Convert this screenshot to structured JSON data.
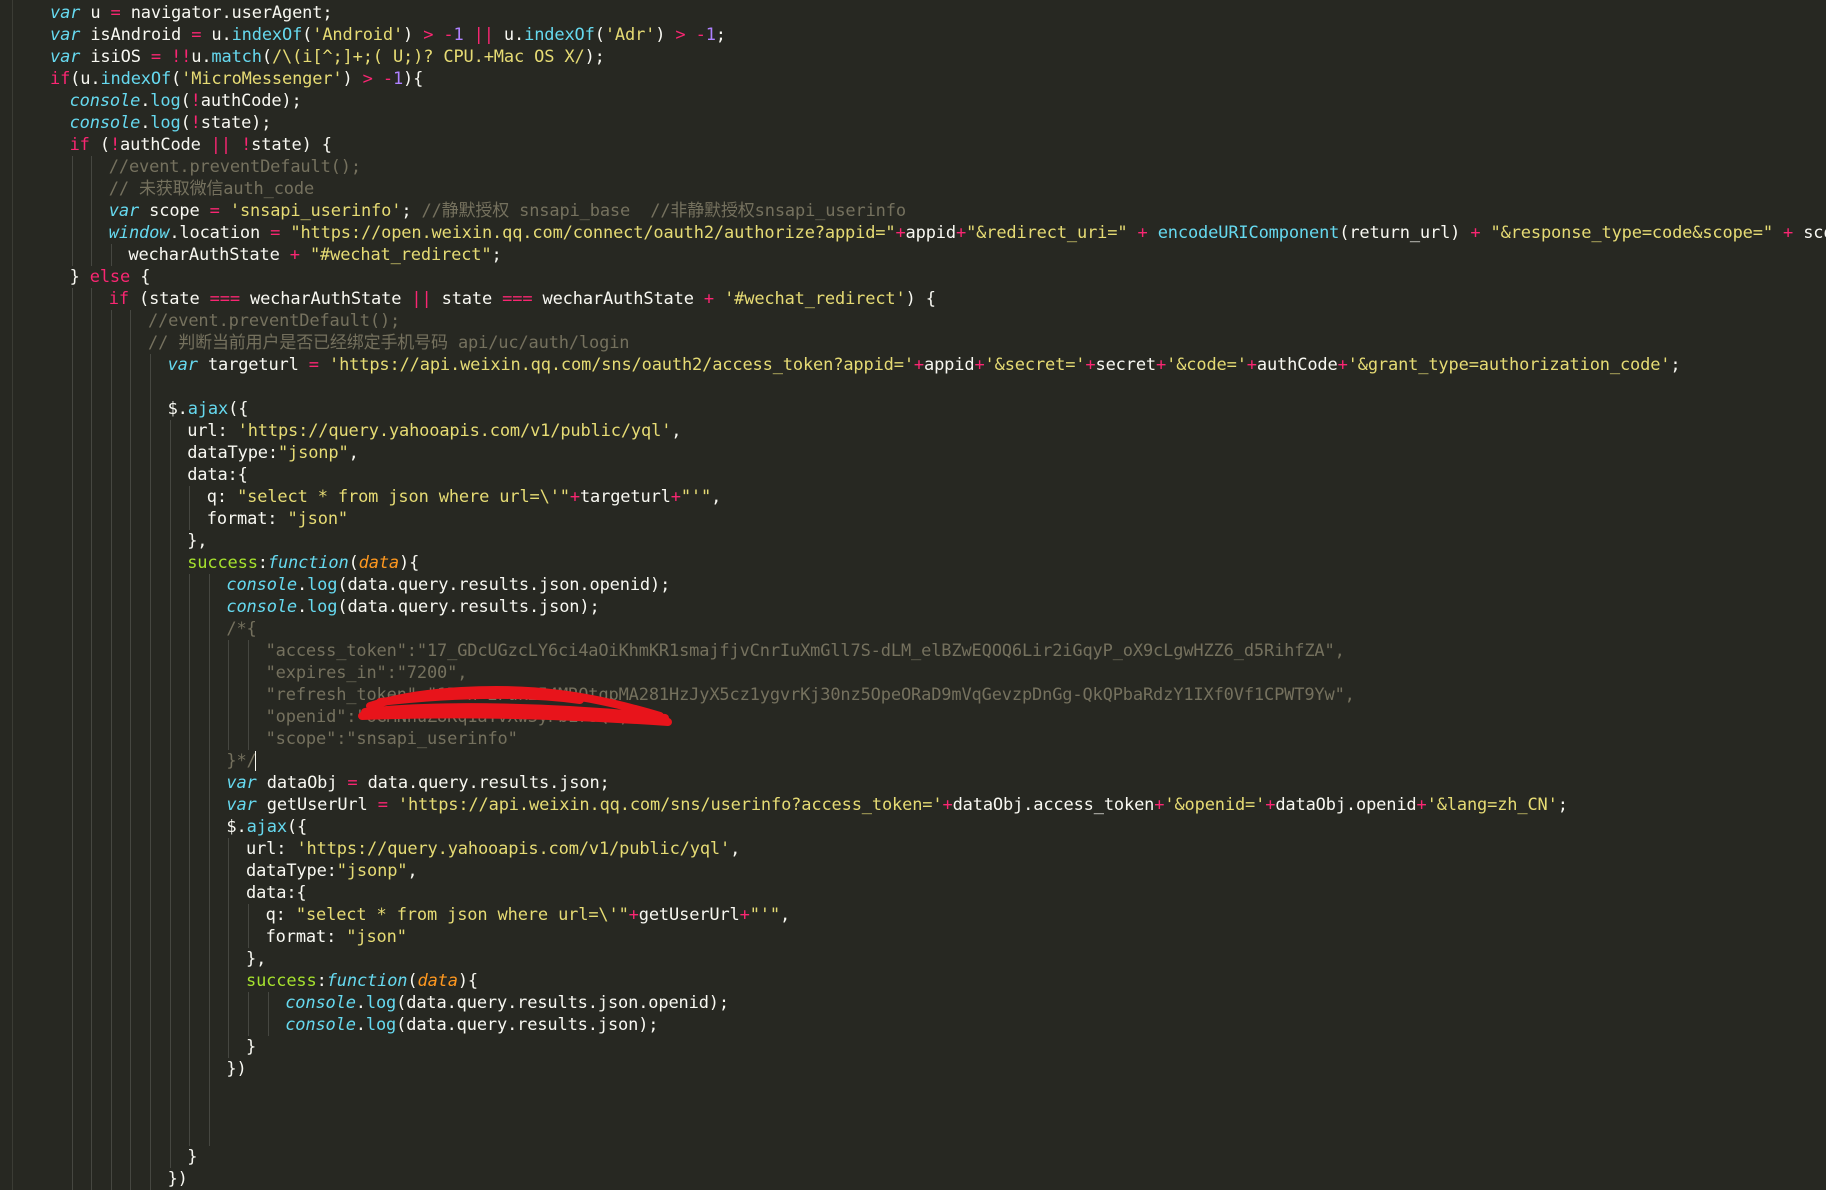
{
  "editor": {
    "colors": {
      "background": "#272822",
      "text": "#f8f8f2",
      "keyword": "#66d9ef",
      "operator": "#f92672",
      "string": "#e6db74",
      "number": "#ae81ff",
      "param": "#fd971f",
      "property": "#a6e22e",
      "comment": "#75715e",
      "redaction": "#e8141b"
    },
    "lines": [
      {
        "indent": 0,
        "tokens": [
          [
            "kw",
            "var"
          ],
          [
            "tx",
            " u "
          ],
          [
            "op",
            "="
          ],
          [
            "tx",
            " navigator.userAgent;"
          ]
        ]
      },
      {
        "indent": 0,
        "tokens": [
          [
            "kw",
            "var"
          ],
          [
            "tx",
            " isAndroid "
          ],
          [
            "op",
            "="
          ],
          [
            "tx",
            " u."
          ],
          [
            "fn",
            "indexOf"
          ],
          [
            "tx",
            "("
          ],
          [
            "st",
            "'Android'"
          ],
          [
            "tx",
            ") "
          ],
          [
            "op",
            ">"
          ],
          [
            "tx",
            " "
          ],
          [
            "op",
            "-"
          ],
          [
            "nu",
            "1"
          ],
          [
            "tx",
            " "
          ],
          [
            "op",
            "||"
          ],
          [
            "tx",
            " u."
          ],
          [
            "fn",
            "indexOf"
          ],
          [
            "tx",
            "("
          ],
          [
            "st",
            "'Adr'"
          ],
          [
            "tx",
            ") "
          ],
          [
            "op",
            ">"
          ],
          [
            "tx",
            " "
          ],
          [
            "op",
            "-"
          ],
          [
            "nu",
            "1"
          ],
          [
            "tx",
            ";"
          ]
        ]
      },
      {
        "indent": 0,
        "tokens": [
          [
            "kw",
            "var"
          ],
          [
            "tx",
            " isiOS "
          ],
          [
            "op",
            "="
          ],
          [
            "tx",
            " "
          ],
          [
            "op",
            "!!"
          ],
          [
            "tx",
            "u."
          ],
          [
            "fn",
            "match"
          ],
          [
            "tx",
            "("
          ],
          [
            "st",
            "/\\(i[^;]+;( U;)? CPU.+Mac OS X/"
          ],
          [
            "tx",
            ");"
          ]
        ]
      },
      {
        "indent": 0,
        "tokens": [
          [
            "kr",
            "if"
          ],
          [
            "tx",
            "(u."
          ],
          [
            "fn",
            "indexOf"
          ],
          [
            "tx",
            "("
          ],
          [
            "st",
            "'MicroMessenger'"
          ],
          [
            "tx",
            ") "
          ],
          [
            "op",
            ">"
          ],
          [
            "tx",
            " "
          ],
          [
            "op",
            "-"
          ],
          [
            "nu",
            "1"
          ],
          [
            "tx",
            "){"
          ]
        ]
      },
      {
        "indent": 1,
        "tokens": [
          [
            "kw",
            "console"
          ],
          [
            "tx",
            "."
          ],
          [
            "fn",
            "log"
          ],
          [
            "tx",
            "("
          ],
          [
            "op",
            "!"
          ],
          [
            "tx",
            "authCode);"
          ]
        ]
      },
      {
        "indent": 1,
        "tokens": [
          [
            "kw",
            "console"
          ],
          [
            "tx",
            "."
          ],
          [
            "fn",
            "log"
          ],
          [
            "tx",
            "("
          ],
          [
            "op",
            "!"
          ],
          [
            "tx",
            "state);"
          ]
        ]
      },
      {
        "indent": 1,
        "tokens": [
          [
            "kr",
            "if"
          ],
          [
            "tx",
            " ("
          ],
          [
            "op",
            "!"
          ],
          [
            "tx",
            "authCode "
          ],
          [
            "op",
            "||"
          ],
          [
            "tx",
            " "
          ],
          [
            "op",
            "!"
          ],
          [
            "tx",
            "state) {"
          ]
        ]
      },
      {
        "indent": 3,
        "tokens": [
          [
            "cm",
            "//event.preventDefault();"
          ]
        ]
      },
      {
        "indent": 3,
        "tokens": [
          [
            "cm",
            "// 未获取微信auth_code"
          ]
        ]
      },
      {
        "indent": 3,
        "tokens": [
          [
            "kw",
            "var"
          ],
          [
            "tx",
            " scope "
          ],
          [
            "op",
            "="
          ],
          [
            "tx",
            " "
          ],
          [
            "st",
            "'snsapi_userinfo'"
          ],
          [
            "tx",
            "; "
          ],
          [
            "cm",
            "//静默授权 snsapi_base  //非静默授权snsapi_userinfo"
          ]
        ]
      },
      {
        "indent": 3,
        "tokens": [
          [
            "kw",
            "window"
          ],
          [
            "tx",
            ".location "
          ],
          [
            "op",
            "="
          ],
          [
            "tx",
            " "
          ],
          [
            "st",
            "\"https://open.weixin.qq.com/connect/oauth2/authorize?appid=\""
          ],
          [
            "op",
            "+"
          ],
          [
            "tx",
            "appid"
          ],
          [
            "op",
            "+"
          ],
          [
            "st",
            "\"&redirect_uri=\""
          ],
          [
            "tx",
            " "
          ],
          [
            "op",
            "+"
          ],
          [
            "tx",
            " "
          ],
          [
            "fn",
            "encodeURIComponent"
          ],
          [
            "tx",
            "(return_url) "
          ],
          [
            "op",
            "+"
          ],
          [
            "tx",
            " "
          ],
          [
            "st",
            "\"&response_type=code&scope=\""
          ],
          [
            "tx",
            " "
          ],
          [
            "op",
            "+"
          ],
          [
            "tx",
            " scop"
          ]
        ]
      },
      {
        "indent": 4,
        "tokens": [
          [
            "tx",
            "wecharAuthState "
          ],
          [
            "op",
            "+"
          ],
          [
            "tx",
            " "
          ],
          [
            "st",
            "\"#wechat_redirect\""
          ],
          [
            "tx",
            ";"
          ]
        ]
      },
      {
        "indent": 1,
        "tokens": [
          [
            "tx",
            "} "
          ],
          [
            "kr",
            "else"
          ],
          [
            "tx",
            " {"
          ]
        ]
      },
      {
        "indent": 3,
        "tokens": [
          [
            "kr",
            "if"
          ],
          [
            "tx",
            " (state "
          ],
          [
            "op",
            "==="
          ],
          [
            "tx",
            " wecharAuthState "
          ],
          [
            "op",
            "||"
          ],
          [
            "tx",
            " state "
          ],
          [
            "op",
            "==="
          ],
          [
            "tx",
            " wecharAuthState "
          ],
          [
            "op",
            "+"
          ],
          [
            "tx",
            " "
          ],
          [
            "st",
            "'#wechat_redirect'"
          ],
          [
            "tx",
            ") {"
          ]
        ]
      },
      {
        "indent": 5,
        "tokens": [
          [
            "cm",
            "//event.preventDefault();"
          ]
        ]
      },
      {
        "indent": 5,
        "tokens": [
          [
            "cm",
            "// 判断当前用户是否已经绑定手机号码 api/uc/auth/login"
          ]
        ]
      },
      {
        "indent": 6,
        "tokens": [
          [
            "kw",
            "var"
          ],
          [
            "tx",
            " targeturl "
          ],
          [
            "op",
            "="
          ],
          [
            "tx",
            " "
          ],
          [
            "st",
            "'https://api.weixin.qq.com/sns/oauth2/access_token?appid='"
          ],
          [
            "op",
            "+"
          ],
          [
            "tx",
            "appid"
          ],
          [
            "op",
            "+"
          ],
          [
            "st",
            "'&secret='"
          ],
          [
            "op",
            "+"
          ],
          [
            "tx",
            "secret"
          ],
          [
            "op",
            "+"
          ],
          [
            "st",
            "'&code='"
          ],
          [
            "op",
            "+"
          ],
          [
            "tx",
            "authCode"
          ],
          [
            "op",
            "+"
          ],
          [
            "st",
            "'&grant_type=authorization_code'"
          ],
          [
            "tx",
            ";"
          ]
        ]
      },
      {
        "indent": 0,
        "tokens": []
      },
      {
        "indent": 6,
        "tokens": [
          [
            "tx",
            "$."
          ],
          [
            "fn",
            "ajax"
          ],
          [
            "tx",
            "({"
          ]
        ]
      },
      {
        "indent": 7,
        "tokens": [
          [
            "tx",
            "url: "
          ],
          [
            "st",
            "'https://query.yahooapis.com/v1/public/yql'"
          ],
          [
            "tx",
            ","
          ]
        ]
      },
      {
        "indent": 7,
        "tokens": [
          [
            "tx",
            "dataType:"
          ],
          [
            "st",
            "\"jsonp\""
          ],
          [
            "tx",
            ","
          ]
        ]
      },
      {
        "indent": 7,
        "tokens": [
          [
            "tx",
            "data:{"
          ]
        ]
      },
      {
        "indent": 8,
        "tokens": [
          [
            "tx",
            "q: "
          ],
          [
            "st",
            "\"select * from json where url=\\'\""
          ],
          [
            "op",
            "+"
          ],
          [
            "tx",
            "targeturl"
          ],
          [
            "op",
            "+"
          ],
          [
            "st",
            "\"'\""
          ],
          [
            "tx",
            ","
          ]
        ]
      },
      {
        "indent": 8,
        "tokens": [
          [
            "tx",
            "format: "
          ],
          [
            "st",
            "\"json\""
          ]
        ]
      },
      {
        "indent": 7,
        "tokens": [
          [
            "tx",
            "},"
          ]
        ]
      },
      {
        "indent": 7,
        "tokens": [
          [
            "pr",
            "success"
          ],
          [
            "tx",
            ":"
          ],
          [
            "kw",
            "function"
          ],
          [
            "tx",
            "("
          ],
          [
            "pa",
            "data"
          ],
          [
            "tx",
            "){"
          ]
        ]
      },
      {
        "indent": 9,
        "tokens": [
          [
            "kw",
            "console"
          ],
          [
            "tx",
            "."
          ],
          [
            "fn",
            "log"
          ],
          [
            "tx",
            "(data.query.results.json.openid);"
          ]
        ]
      },
      {
        "indent": 9,
        "tokens": [
          [
            "kw",
            "console"
          ],
          [
            "tx",
            "."
          ],
          [
            "fn",
            "log"
          ],
          [
            "tx",
            "(data.query.results.json);"
          ]
        ]
      },
      {
        "indent": 9,
        "tokens": [
          [
            "cm",
            "/*{"
          ]
        ]
      },
      {
        "indent": 11,
        "tokens": [
          [
            "cm",
            "\"access_token\":\"17_GDcUGzcLY6ci4aOiKhmKR1smajfjvCnrIuXmGll7S-dLM_elBZwEQOQ6Lir2iGqyP_oX9cLgwHZZ6_d5RihfZA\","
          ]
        ]
      },
      {
        "indent": 11,
        "tokens": [
          [
            "cm",
            "\"expires_in\":\"7200\","
          ]
        ]
      },
      {
        "indent": 11,
        "tokens": [
          [
            "cm",
            "\"refresh_token\":\"17_n_2Fuk254MROtqpMA281HzJyX5cz1ygvrKj30nz5OpeORaD9mVqGevzpDnGg-QkQPbaRdzY1IXf0Vf1CPWT9Yw\","
          ]
        ]
      },
      {
        "indent": 11,
        "tokens": [
          [
            "cm",
            "\"openid\":\"oGMNhuZ8Kq1aTvXw3yPbE7sQ\","
          ]
        ]
      },
      {
        "indent": 11,
        "tokens": [
          [
            "cm",
            "\"scope\":\"snsapi_userinfo\""
          ]
        ]
      },
      {
        "indent": 9,
        "tokens": [
          [
            "cm",
            "}*/"
          ]
        ]
      },
      {
        "indent": 9,
        "tokens": [
          [
            "kw",
            "var"
          ],
          [
            "tx",
            " dataObj "
          ],
          [
            "op",
            "="
          ],
          [
            "tx",
            " data.query.results.json;"
          ]
        ]
      },
      {
        "indent": 9,
        "tokens": [
          [
            "kw",
            "var"
          ],
          [
            "tx",
            " getUserUrl "
          ],
          [
            "op",
            "="
          ],
          [
            "tx",
            " "
          ],
          [
            "st",
            "'https://api.weixin.qq.com/sns/userinfo?access_token='"
          ],
          [
            "op",
            "+"
          ],
          [
            "tx",
            "dataObj.access_token"
          ],
          [
            "op",
            "+"
          ],
          [
            "st",
            "'&openid='"
          ],
          [
            "op",
            "+"
          ],
          [
            "tx",
            "dataObj.openid"
          ],
          [
            "op",
            "+"
          ],
          [
            "st",
            "'&lang=zh_CN'"
          ],
          [
            "tx",
            ";"
          ]
        ]
      },
      {
        "indent": 9,
        "tokens": [
          [
            "tx",
            "$."
          ],
          [
            "fn",
            "ajax"
          ],
          [
            "tx",
            "({"
          ]
        ]
      },
      {
        "indent": 10,
        "tokens": [
          [
            "tx",
            "url: "
          ],
          [
            "st",
            "'https://query.yahooapis.com/v1/public/yql'"
          ],
          [
            "tx",
            ","
          ]
        ]
      },
      {
        "indent": 10,
        "tokens": [
          [
            "tx",
            "dataType:"
          ],
          [
            "st",
            "\"jsonp\""
          ],
          [
            "tx",
            ","
          ]
        ]
      },
      {
        "indent": 10,
        "tokens": [
          [
            "tx",
            "data:{"
          ]
        ]
      },
      {
        "indent": 11,
        "tokens": [
          [
            "tx",
            "q: "
          ],
          [
            "st",
            "\"select * from json where url=\\'\""
          ],
          [
            "op",
            "+"
          ],
          [
            "tx",
            "getUserUrl"
          ],
          [
            "op",
            "+"
          ],
          [
            "st",
            "\"'\""
          ],
          [
            "tx",
            ","
          ]
        ]
      },
      {
        "indent": 11,
        "tokens": [
          [
            "tx",
            "format: "
          ],
          [
            "st",
            "\"json\""
          ]
        ]
      },
      {
        "indent": 10,
        "tokens": [
          [
            "tx",
            "},"
          ]
        ]
      },
      {
        "indent": 10,
        "tokens": [
          [
            "pr",
            "success"
          ],
          [
            "tx",
            ":"
          ],
          [
            "kw",
            "function"
          ],
          [
            "tx",
            "("
          ],
          [
            "pa",
            "data"
          ],
          [
            "tx",
            "){"
          ]
        ]
      },
      {
        "indent": 12,
        "tokens": [
          [
            "kw",
            "console"
          ],
          [
            "tx",
            "."
          ],
          [
            "fn",
            "log"
          ],
          [
            "tx",
            "(data.query.results.json.openid);"
          ]
        ]
      },
      {
        "indent": 12,
        "tokens": [
          [
            "kw",
            "console"
          ],
          [
            "tx",
            "."
          ],
          [
            "fn",
            "log"
          ],
          [
            "tx",
            "(data.query.results.json);"
          ]
        ]
      },
      {
        "indent": 10,
        "tokens": [
          [
            "tx",
            "}"
          ]
        ]
      },
      {
        "indent": 9,
        "tokens": [
          [
            "tx",
            "})"
          ]
        ]
      },
      {
        "indent": 0,
        "tokens": []
      },
      {
        "indent": 0,
        "tokens": []
      },
      {
        "indent": 0,
        "tokens": []
      },
      {
        "indent": 7,
        "tokens": [
          [
            "tx",
            "}"
          ]
        ]
      },
      {
        "indent": 6,
        "tokens": [
          [
            "tx",
            "})"
          ]
        ]
      }
    ]
  }
}
